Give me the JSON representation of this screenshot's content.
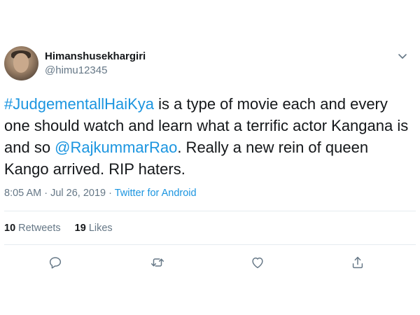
{
  "author": {
    "display_name": "Himanshusekhargiri",
    "handle": "@himu12345"
  },
  "tweet": {
    "hashtag": "#JudgementallHaiKya",
    "text_1": " is a type of movie each and every one should watch and learn what a terrific actor Kangana is and so ",
    "mention": "@RajkummarRao",
    "text_2": ". Really a new rein of queen Kango arrived. RIP haters."
  },
  "meta": {
    "time": "8:05 AM",
    "separator": " · ",
    "date": "Jul 26, 2019",
    "source": "Twitter for Android"
  },
  "stats": {
    "retweets_count": "10",
    "retweets_label": "Retweets",
    "likes_count": "19",
    "likes_label": "Likes"
  },
  "colors": {
    "link": "#1b95e0",
    "secondary_text": "#657786",
    "divider": "#e6ecf0"
  },
  "icons": [
    "chevron-down-icon",
    "reply-icon",
    "retweet-icon",
    "like-icon",
    "share-icon"
  ]
}
